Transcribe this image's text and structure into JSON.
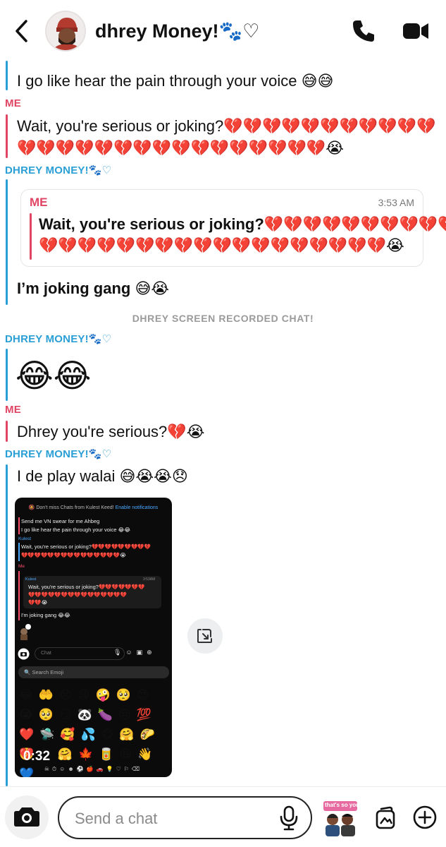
{
  "header": {
    "title": "dhrey Money!🐾♡"
  },
  "messages": {
    "partial_text": "I go like hear the pain through your voice 😅😅",
    "sender_me_1": "ME",
    "me_msg_line1": "Wait, you're serious or joking?💔💔💔💔💔💔💔💔💔💔💔",
    "me_msg_line2": "💔💔💔💔💔💔💔💔💔💔💔💔💔💔💔💔😭",
    "sender_them_1": "DHREY MONEY!🐾♡",
    "quote_sender": "ME",
    "quote_time": "3:53 AM",
    "quote_line1": "Wait, you're serious or joking?💔💔💔💔💔💔💔💔💔💔",
    "quote_line2": "💔💔💔💔💔💔💔💔💔💔💔💔💔💔💔💔💔💔😭",
    "them_msg_1": "I’m joking gang 😅😭",
    "system_notice": "DHREY SCREEN RECORDED CHAT!",
    "sender_them_2": "DHREY MONEY!🐾♡",
    "them_msg_2": "😂😂",
    "sender_me_2": "ME",
    "me_msg_2": "Dhrey you're serious?💔😭",
    "sender_them_3": "DHREY MONEY!🐾♡",
    "them_msg_3": "I de play walai 😅😭😭😞"
  },
  "video": {
    "notice": "Don't miss Chats from Kulest Keed!",
    "notice_link": "Enable notifications",
    "line1": "Send me VN swear for me Ahbeg",
    "line2": "I go like hear the pain through your voice 😂😂",
    "sender1": "Kulest",
    "line3": "Wait, you're serious or joking?💔💔💔💔💔💔💔💔💔",
    "line4": "💔💔💔💔💔💔💔💔💔💔💔💔💔💔💔😭",
    "sender2": "Me",
    "card_sender": "Kulest",
    "card_time": "3:53AM",
    "card_line1": "Wait, you're serious or joking?💔💔💔💔💔💔💔",
    "card_line2": "💔💔💔💔💔💔💔💔💔💔💔💔💔💔💔",
    "card_line3": "💔💔😭",
    "line5": "I'm joking gang 😂😂",
    "chat_placeholder": "Chat",
    "search_placeholder": "Search Emoji",
    "emoji_rows": [
      "😂🤲😞😩🤪🥺😍😢",
      "😭🥺😏🐼🍆😢💯😏",
      "❤️🛸🥰💦😋🤗🌮🥺",
      "💔😍🤗🍁🥫😆👋💙"
    ],
    "duration": "0:32",
    "bottom_icons": "☠⏱☺☻⚽🍎🚗💡♡⚐⌫"
  },
  "composer": {
    "placeholder": "Send a chat",
    "sticker_text": "that's so you"
  },
  "colors": {
    "me": "#e04563",
    "them": "#2a9fd6",
    "system": "#9a9a9a"
  }
}
